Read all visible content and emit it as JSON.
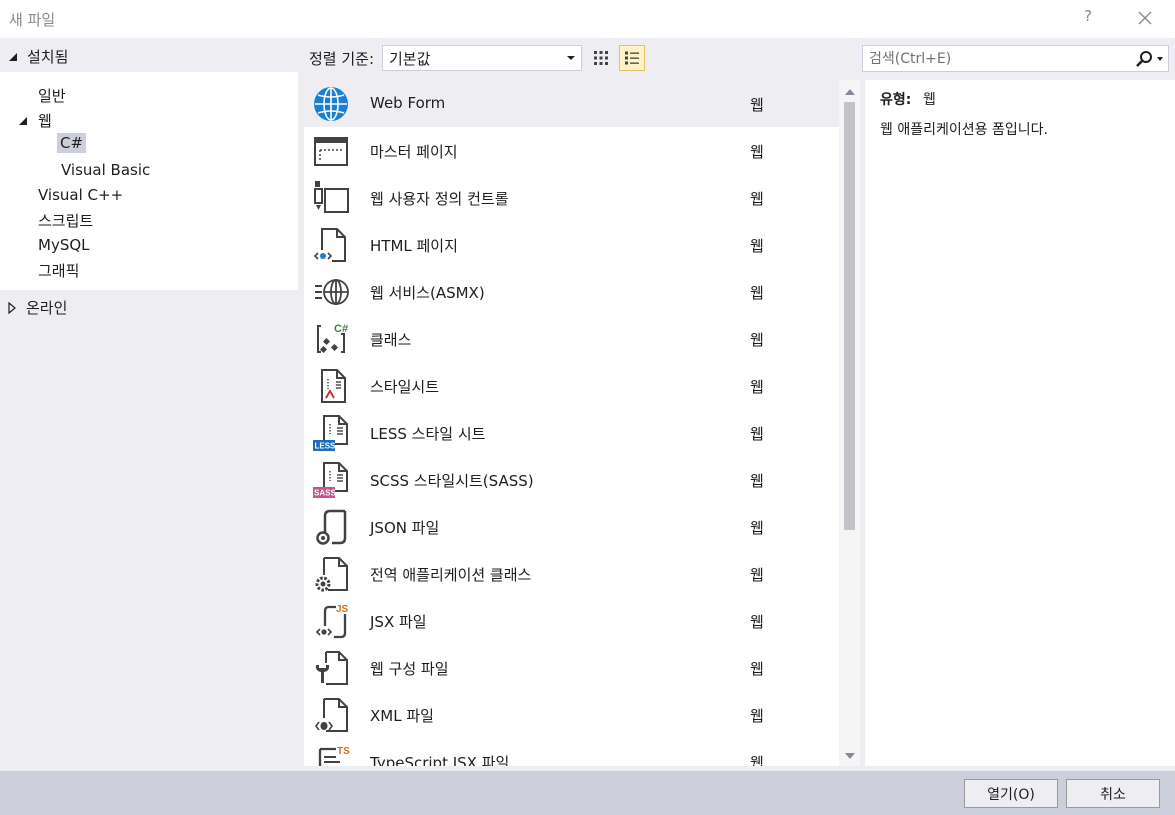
{
  "window": {
    "title": "새 파일",
    "help_label": "?"
  },
  "tree": {
    "installed_label": "설치됨",
    "items": [
      {
        "label": "일반"
      },
      {
        "label": "웹"
      },
      {
        "label": "C#"
      },
      {
        "label": "Visual Basic"
      },
      {
        "label": "Visual C++"
      },
      {
        "label": "스크립트"
      },
      {
        "label": "MySQL"
      },
      {
        "label": "그래픽"
      }
    ],
    "online_label": "온라인"
  },
  "toolbar": {
    "sort_label": "정렬 기준:",
    "sort_value": "기본값",
    "view_mode": "list"
  },
  "templates": [
    {
      "name": "Web Form",
      "category": "웹",
      "icon": "web-form-icon",
      "selected": true
    },
    {
      "name": "마스터 페이지",
      "category": "웹",
      "icon": "master-page-icon"
    },
    {
      "name": "웹 사용자 정의 컨트롤",
      "category": "웹",
      "icon": "user-control-icon"
    },
    {
      "name": "HTML 페이지",
      "category": "웹",
      "icon": "html-page-icon"
    },
    {
      "name": "웹 서비스(ASMX)",
      "category": "웹",
      "icon": "web-service-icon"
    },
    {
      "name": "클래스",
      "category": "웹",
      "icon": "class-icon",
      "badge": "C#"
    },
    {
      "name": "스타일시트",
      "category": "웹",
      "icon": "stylesheet-icon"
    },
    {
      "name": "LESS 스타일 시트",
      "category": "웹",
      "icon": "less-icon",
      "badge": "LESS"
    },
    {
      "name": "SCSS 스타일시트(SASS)",
      "category": "웹",
      "icon": "sass-icon",
      "badge": "SASS"
    },
    {
      "name": "JSON 파일",
      "category": "웹",
      "icon": "json-file-icon"
    },
    {
      "name": "전역 애플리케이션 클래스",
      "category": "웹",
      "icon": "global-app-icon"
    },
    {
      "name": "JSX 파일",
      "category": "웹",
      "icon": "jsx-file-icon",
      "badge": "JS"
    },
    {
      "name": "웹 구성 파일",
      "category": "웹",
      "icon": "web-config-icon"
    },
    {
      "name": "XML 파일",
      "category": "웹",
      "icon": "xml-file-icon"
    },
    {
      "name": "TypeScript JSX 파일",
      "category": "웹",
      "icon": "tsx-file-icon",
      "badge": "TS"
    }
  ],
  "search": {
    "placeholder": "검색(Ctrl+E)",
    "value": ""
  },
  "details": {
    "type_label": "유형:",
    "type_value": "웹",
    "description": "웹 애플리케이션용 폼입니다."
  },
  "buttons": {
    "open_label": "열기(O)",
    "cancel_label": "취소"
  },
  "colors": {
    "background": "#eeeef2",
    "selection": "#cccedb",
    "globe_blue": "#1a7fd4",
    "badge_green": "#388a34",
    "badge_orange": "#d0731a",
    "badge_blue": "#1f6bb8",
    "badge_pink": "#c6538c"
  }
}
